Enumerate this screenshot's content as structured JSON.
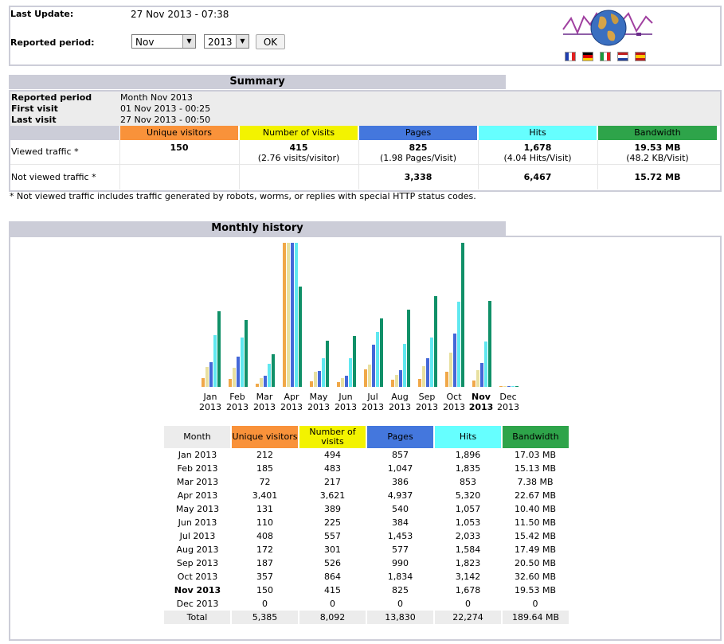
{
  "header": {
    "last_update_label": "Last Update:",
    "last_update_value": "27 Nov 2013 - 07:38",
    "period_label": "Reported period:",
    "month_select": "Nov",
    "year_select": "2013",
    "ok_label": "OK"
  },
  "summary": {
    "title": "Summary",
    "reported_period_label": "Reported period",
    "reported_period_value": "Month Nov 2013",
    "first_visit_label": "First visit",
    "first_visit_value": "01 Nov 2013 - 00:25",
    "last_visit_label": "Last visit",
    "last_visit_value": "27 Nov 2013 - 00:50",
    "columns": [
      "Unique visitors",
      "Number of visits",
      "Pages",
      "Hits",
      "Bandwidth"
    ],
    "viewed_label": "Viewed traffic *",
    "viewed": [
      {
        "main": "150",
        "sub": ""
      },
      {
        "main": "415",
        "sub": "(2.76 visits/visitor)"
      },
      {
        "main": "825",
        "sub": "(1.98 Pages/Visit)"
      },
      {
        "main": "1,678",
        "sub": "(4.04 Hits/Visit)"
      },
      {
        "main": "19.53 MB",
        "sub": "(48.2 KB/Visit)"
      }
    ],
    "not_viewed_label": "Not viewed traffic *",
    "not_viewed": [
      "",
      "",
      "3,338",
      "6,467",
      "15.72 MB"
    ],
    "footnote": "* Not viewed traffic includes traffic generated by robots, worms, or replies with special HTTP status codes."
  },
  "history": {
    "title": "Monthly history",
    "table_headers": [
      "Month",
      "Unique visitors",
      "Number of visits",
      "Pages",
      "Hits",
      "Bandwidth"
    ],
    "rows": [
      {
        "month": "Jan 2013",
        "visitors": "212",
        "visits": "494",
        "pages": "857",
        "hits": "1,896",
        "bandwidth": "17.03 MB"
      },
      {
        "month": "Feb 2013",
        "visitors": "185",
        "visits": "483",
        "pages": "1,047",
        "hits": "1,835",
        "bandwidth": "15.13 MB"
      },
      {
        "month": "Mar 2013",
        "visitors": "72",
        "visits": "217",
        "pages": "386",
        "hits": "853",
        "bandwidth": "7.38 MB"
      },
      {
        "month": "Apr 2013",
        "visitors": "3,401",
        "visits": "3,621",
        "pages": "4,937",
        "hits": "5,320",
        "bandwidth": "22.67 MB"
      },
      {
        "month": "May 2013",
        "visitors": "131",
        "visits": "389",
        "pages": "540",
        "hits": "1,057",
        "bandwidth": "10.40 MB"
      },
      {
        "month": "Jun 2013",
        "visitors": "110",
        "visits": "225",
        "pages": "384",
        "hits": "1,053",
        "bandwidth": "11.50 MB"
      },
      {
        "month": "Jul 2013",
        "visitors": "408",
        "visits": "557",
        "pages": "1,453",
        "hits": "2,033",
        "bandwidth": "15.42 MB"
      },
      {
        "month": "Aug 2013",
        "visitors": "172",
        "visits": "301",
        "pages": "577",
        "hits": "1,584",
        "bandwidth": "17.49 MB"
      },
      {
        "month": "Sep 2013",
        "visitors": "187",
        "visits": "526",
        "pages": "990",
        "hits": "1,823",
        "bandwidth": "20.50 MB"
      },
      {
        "month": "Oct 2013",
        "visitors": "357",
        "visits": "864",
        "pages": "1,834",
        "hits": "3,142",
        "bandwidth": "32.60 MB"
      },
      {
        "month": "Nov 2013",
        "visitors": "150",
        "visits": "415",
        "pages": "825",
        "hits": "1,678",
        "bandwidth": "19.53 MB",
        "current": true
      },
      {
        "month": "Dec 2013",
        "visitors": "0",
        "visits": "0",
        "pages": "0",
        "hits": "0",
        "bandwidth": "0"
      }
    ],
    "total": {
      "month": "Total",
      "visitors": "5,385",
      "visits": "8,092",
      "pages": "13,830",
      "hits": "22,274",
      "bandwidth": "189.64 MB"
    }
  },
  "chart_data": {
    "type": "bar",
    "categories": [
      "Jan",
      "Feb",
      "Mar",
      "Apr",
      "May",
      "Jun",
      "Jul",
      "Aug",
      "Sep",
      "Oct",
      "Nov",
      "Dec"
    ],
    "year_labels": [
      "2013",
      "2013",
      "2013",
      "2013",
      "2013",
      "2013",
      "2013",
      "2013",
      "2013",
      "2013",
      "2013",
      "2013"
    ],
    "current_index": 10,
    "series": [
      {
        "values": [
          212,
          185,
          72,
          3401,
          131,
          110,
          408,
          172,
          187,
          357,
          150,
          0
        ],
        "color": "#f0a848"
      },
      {
        "values": [
          494,
          483,
          217,
          3621,
          389,
          225,
          557,
          301,
          526,
          864,
          415,
          0
        ],
        "color": "#e8e0a0"
      },
      {
        "values": [
          857,
          1047,
          386,
          4937,
          540,
          384,
          1453,
          577,
          990,
          1834,
          825,
          0
        ],
        "color": "#4468d8"
      },
      {
        "values": [
          1896,
          1835,
          853,
          5320,
          1057,
          1053,
          2033,
          1584,
          1823,
          3142,
          1678,
          0
        ],
        "color": "#60e8f0"
      },
      {
        "values": [
          17.03,
          15.13,
          7.38,
          22.67,
          10.4,
          11.5,
          15.42,
          17.49,
          20.5,
          32.6,
          19.53,
          0
        ],
        "color": "#109068"
      }
    ]
  },
  "colors": {
    "visitors": "#f9923a",
    "visits": "#f3f300",
    "pages": "#4477dd",
    "hits": "#66ffff",
    "bandwidth": "#2ea44a",
    "frame": "#cccdd8",
    "label_bg": "#ececec"
  }
}
